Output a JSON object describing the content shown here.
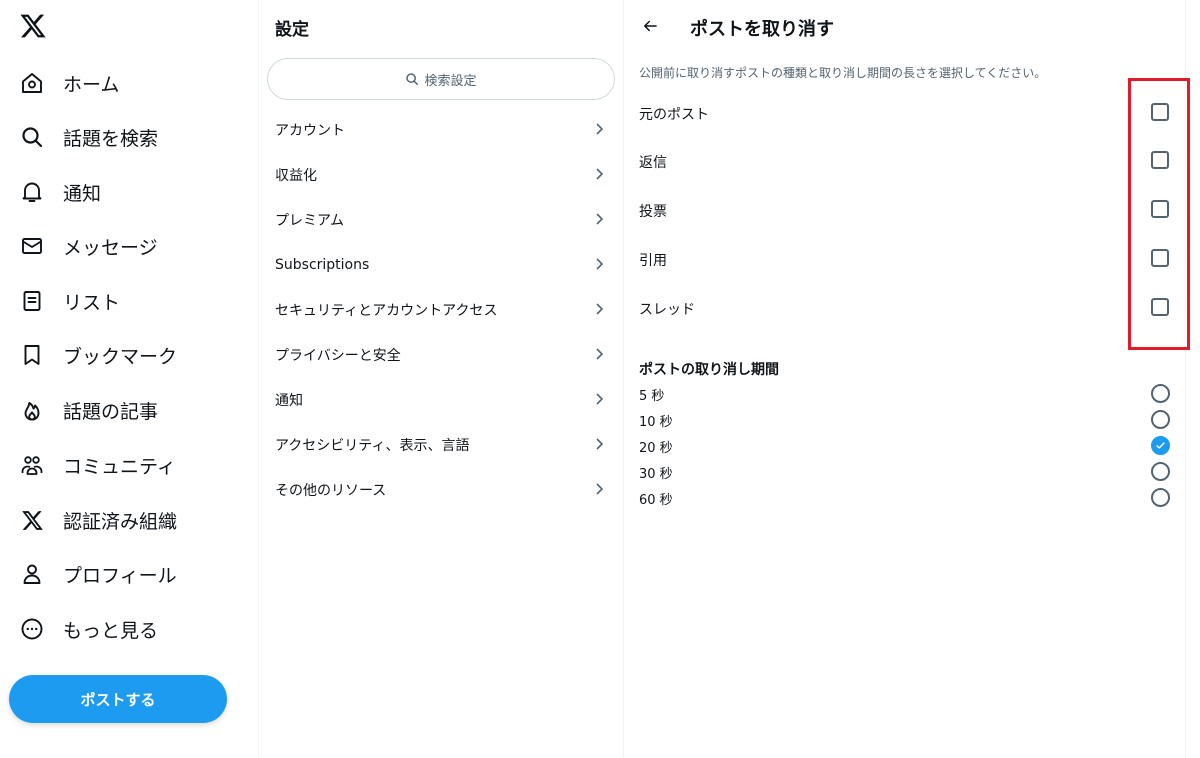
{
  "nav": {
    "items": [
      {
        "label": "ホーム",
        "icon": "home-icon"
      },
      {
        "label": "話題を検索",
        "icon": "search-icon"
      },
      {
        "label": "通知",
        "icon": "bell-icon"
      },
      {
        "label": "メッセージ",
        "icon": "mail-icon"
      },
      {
        "label": "リスト",
        "icon": "list-icon"
      },
      {
        "label": "ブックマーク",
        "icon": "bookmark-icon"
      },
      {
        "label": "話題の記事",
        "icon": "flame-icon"
      },
      {
        "label": "コミュニティ",
        "icon": "communities-icon"
      },
      {
        "label": "認証済み組織",
        "icon": "x-logo-icon"
      },
      {
        "label": "プロフィール",
        "icon": "profile-icon"
      },
      {
        "label": "もっと見る",
        "icon": "more-icon"
      }
    ],
    "post_button": "ポストする"
  },
  "settings": {
    "title": "設定",
    "search_placeholder": "検索設定",
    "items": [
      {
        "label": "アカウント"
      },
      {
        "label": "収益化"
      },
      {
        "label": "プレミアム"
      },
      {
        "label": "Subscriptions"
      },
      {
        "label": "セキュリティとアカウントアクセス"
      },
      {
        "label": "プライバシーと安全"
      },
      {
        "label": "通知"
      },
      {
        "label": "アクセシビリティ、表示、言語"
      },
      {
        "label": "その他のリソース"
      }
    ]
  },
  "detail": {
    "title": "ポストを取り消す",
    "description": "公開前に取り消すポストの種類と取り消し期間の長さを選択してください。",
    "post_types": [
      {
        "label": "元のポスト",
        "checked": false
      },
      {
        "label": "返信",
        "checked": false
      },
      {
        "label": "投票",
        "checked": false
      },
      {
        "label": "引用",
        "checked": false
      },
      {
        "label": "スレッド",
        "checked": false
      }
    ],
    "period_title": "ポストの取り消し期間",
    "periods": [
      {
        "label": "5 秒",
        "selected": false
      },
      {
        "label": "10 秒",
        "selected": false
      },
      {
        "label": "20 秒",
        "selected": true
      },
      {
        "label": "30 秒",
        "selected": false
      },
      {
        "label": "60 秒",
        "selected": false
      }
    ]
  },
  "colors": {
    "accent": "#1d9bf0",
    "highlight": "#e21b2b",
    "text": "#0f1419",
    "muted": "#536471"
  }
}
